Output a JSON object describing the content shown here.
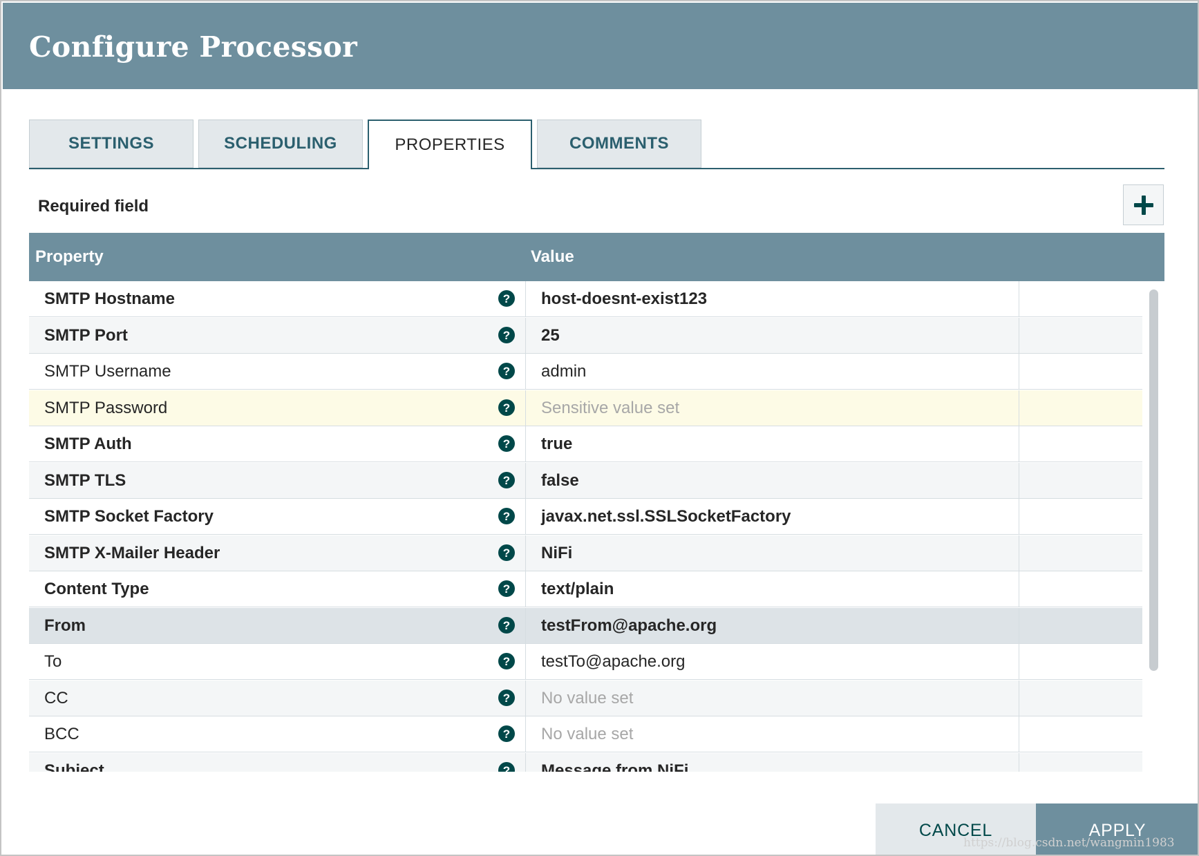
{
  "dialog": {
    "title": "Configure Processor"
  },
  "tabs": [
    {
      "label": "SETTINGS",
      "active": false
    },
    {
      "label": "SCHEDULING",
      "active": false
    },
    {
      "label": "PROPERTIES",
      "active": true
    },
    {
      "label": "COMMENTS",
      "active": false
    }
  ],
  "properties": {
    "required_label": "Required field",
    "add_icon": "plus-icon",
    "columns": {
      "property": "Property",
      "value": "Value"
    },
    "help_icon_glyph": "?",
    "rows": [
      {
        "name": "SMTP Hostname",
        "value": "host-doesnt-exist123",
        "required": true,
        "unset": false
      },
      {
        "name": "SMTP Port",
        "value": "25",
        "required": true,
        "unset": false
      },
      {
        "name": "SMTP Username",
        "value": "admin",
        "required": false,
        "unset": false
      },
      {
        "name": "SMTP Password",
        "value": "Sensitive value set",
        "required": false,
        "unset": true,
        "sensitive": true
      },
      {
        "name": "SMTP Auth",
        "value": "true",
        "required": true,
        "unset": false
      },
      {
        "name": "SMTP TLS",
        "value": "false",
        "required": true,
        "unset": false
      },
      {
        "name": "SMTP Socket Factory",
        "value": "javax.net.ssl.SSLSocketFactory",
        "required": true,
        "unset": false
      },
      {
        "name": "SMTP X-Mailer Header",
        "value": "NiFi",
        "required": true,
        "unset": false
      },
      {
        "name": "Content Type",
        "value": "text/plain",
        "required": true,
        "unset": false
      },
      {
        "name": "From",
        "value": "testFrom@apache.org",
        "required": true,
        "unset": false,
        "selected": true
      },
      {
        "name": "To",
        "value": "testTo@apache.org",
        "required": false,
        "unset": false
      },
      {
        "name": "CC",
        "value": "No value set",
        "required": false,
        "unset": true
      },
      {
        "name": "BCC",
        "value": "No value set",
        "required": false,
        "unset": true
      },
      {
        "name": "Subject",
        "value": "Message from NiFi",
        "required": true,
        "unset": false
      }
    ]
  },
  "footer": {
    "cancel_label": "CANCEL",
    "apply_label": "APPLY"
  },
  "watermark": "https://blog.csdn.net/wangmin1983",
  "colors": {
    "header": "#6e8f9e",
    "accent": "#004849",
    "tab_border": "#2b5f6e",
    "sensitive_row": "#fdfbe6",
    "selected_row": "#dde3e7"
  }
}
